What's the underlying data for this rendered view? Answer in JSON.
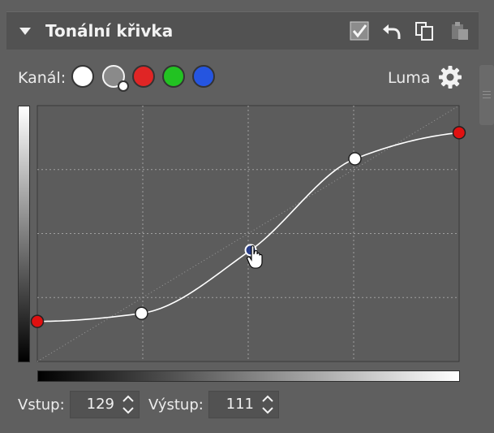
{
  "panel": {
    "title": "Tonální křivka",
    "header_icons": [
      "checkbox-checked-icon",
      "undo-arrow-icon",
      "copy-icon",
      "paste-icon"
    ]
  },
  "channel": {
    "label": "Kanál:",
    "options": [
      {
        "name": "white",
        "color": "#ffffff"
      },
      {
        "name": "luma",
        "color": "#8a8a8a",
        "selected": true
      },
      {
        "name": "red",
        "color": "#e02525"
      },
      {
        "name": "green",
        "color": "#22c222"
      },
      {
        "name": "blue",
        "color": "#2555e0"
      }
    ],
    "mode_label": "Luma"
  },
  "curve": {
    "grid_divisions": 4,
    "input_range": [
      0,
      255
    ],
    "output_range": [
      0,
      255
    ],
    "points": [
      {
        "input": 0,
        "output": 40,
        "endpoint": true
      },
      {
        "input": 63,
        "output": 48
      },
      {
        "input": 129,
        "output": 111,
        "active": true
      },
      {
        "input": 192,
        "output": 202
      },
      {
        "input": 255,
        "output": 228,
        "endpoint": true
      }
    ]
  },
  "inputs": {
    "vstup_label": "Vstup:",
    "vstup_value": "129",
    "vystup_label": "Výstup:",
    "vystup_value": "111"
  },
  "colors": {
    "panel_bg": "#5f5f5f",
    "header_bg": "#525252",
    "endpoint": "#e01010",
    "active_point": "#2a3f8a"
  }
}
